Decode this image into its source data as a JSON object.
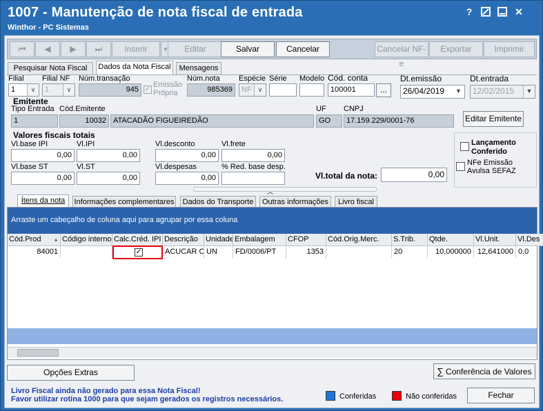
{
  "window": {
    "title": "1007 - Manutenção de nota fiscal de entrada",
    "subtitle": "Winthor - PC Sistemas",
    "help_label": "?",
    "close_label": "✕"
  },
  "toolbar": {
    "first": "⏮",
    "prev": "◀",
    "next": "▶",
    "last": "⏭",
    "inserir": "Inserir",
    "editar": "Editar",
    "salvar": "Salvar",
    "cancelar": "Cancelar",
    "cancelar_nfe": "Cancelar NF-e",
    "exportar": "Exportar",
    "imprimir": "Imprimir"
  },
  "tabs": {
    "pesquisar": "Pesquisar Nota Fiscal",
    "dados": "Dados da Nota Fiscal",
    "mensagens": "Mensagens"
  },
  "header_fields": {
    "filial_label": "Filial",
    "filial_value": "1",
    "filial_nf_label": "Filial NF",
    "filial_nf_value": "1",
    "num_transacao_label": "Núm.transação",
    "num_transacao_value": "945",
    "emissao_propria_label": "Emissão Própria",
    "num_nota_label": "Núm.nota",
    "num_nota_value": "985369",
    "especie_label": "Espécie",
    "especie_value": "NF",
    "serie_label": "Série",
    "serie_value": "",
    "modelo_label": "Modelo",
    "modelo_value": "",
    "cod_conta_label": "Cód. conta",
    "cod_conta_value": "100001",
    "ellipsis": "...",
    "dt_emissao_label": "Dt.emissão",
    "dt_emissao_value": "26/04/2019",
    "dt_entrada_label": "Dt.entrada",
    "dt_entrada_value": "12/02/2015"
  },
  "emitente": {
    "section": "Emitente",
    "tipo_entrada_label": "Tipo Entrada",
    "tipo_entrada_value": "1",
    "cod_emitente_label": "Cód.Emitente",
    "cod_emitente_value": "10032",
    "nome_value": "ATACADÃO FIGUEIREDÃO",
    "uf_label": "UF",
    "uf_value": "GO",
    "cnpj_label": "CNPJ",
    "cnpj_value": "17.159.229/0001-76",
    "editar_button": "Editar Emitente"
  },
  "valores": {
    "section": "Valores fiscais totais",
    "vl_base_ipi_label": "Vl.base IPI",
    "vl_base_ipi": "0,00",
    "vl_ipi_label": "Vl.IPI",
    "vl_ipi": "0,00",
    "vl_desconto_label": "Vl.desconto",
    "vl_desconto": "0,00",
    "vl_frete_label": "Vl.frete",
    "vl_frete": "0,00",
    "vl_base_st_label": "Vl.base ST",
    "vl_base_st": "0,00",
    "vl_st_label": "Vl.ST",
    "vl_st": "0,00",
    "vl_despesas_label": "Vl.despesas",
    "vl_despesas": "0,00",
    "red_base_label": "% Red. base desp.",
    "red_base": "",
    "vl_total_label": "Vl.total da nota:",
    "vl_total": "0,00",
    "lancamento_label": "Lançamento Conferido",
    "nfe_avulsa_label": "NFe Emissão Avulsa SEFAZ"
  },
  "sub_tabs": [
    "Ítens da nota",
    "Informações complementares",
    "Dados do Transporte",
    "Outras informações",
    "Livro fiscal"
  ],
  "grid": {
    "group_hint": "Arraste um cabeçalho de coluna aqui para agrupar por essa coluna",
    "columns": [
      "Cód.Prod",
      "Código interno",
      "Calc.Créd. IPI",
      "Descrição",
      "Unidade",
      "Embalagem",
      "CFOP",
      "Cód.Orig.Merc.",
      "S.Trib.",
      "Qtde.",
      "Vl.Unit.",
      "Vl.Des"
    ],
    "sort_indicator": "▲",
    "rows": [
      {
        "cod_prod": "84001",
        "codigo_interno": "",
        "calc_cred_ipi": true,
        "descricao": "ACUCAR CR",
        "unidade": "UN",
        "embalagem": "FD/0006/PT",
        "cfop": "1353",
        "cod_orig": "",
        "s_trib": "20",
        "qtde": "10,000000",
        "vl_unit": "12,641000",
        "vl_des": "0,0"
      }
    ]
  },
  "bottom": {
    "opcoes_extras": "Opções Extras",
    "conferencia": "Conferência de Valores",
    "msg1": "Livro Fiscal ainda não gerado para essa Nota Fiscal!",
    "msg2": "Favor utilizar rotina 1000 para que sejam gerados os registros necessários.",
    "legend_conferidas": "Conferidas",
    "legend_nao_conferidas": "Não conferidas",
    "fechar": "Fechar"
  },
  "colors": {
    "title_bar": "#2a6fb5",
    "grid_band": "#2c63ad",
    "highlight_box": "#e8000b",
    "message_text": "#1c3fa8",
    "legend_conferidas": "#1f78d6",
    "legend_nao_conferidas": "#e8000b"
  }
}
